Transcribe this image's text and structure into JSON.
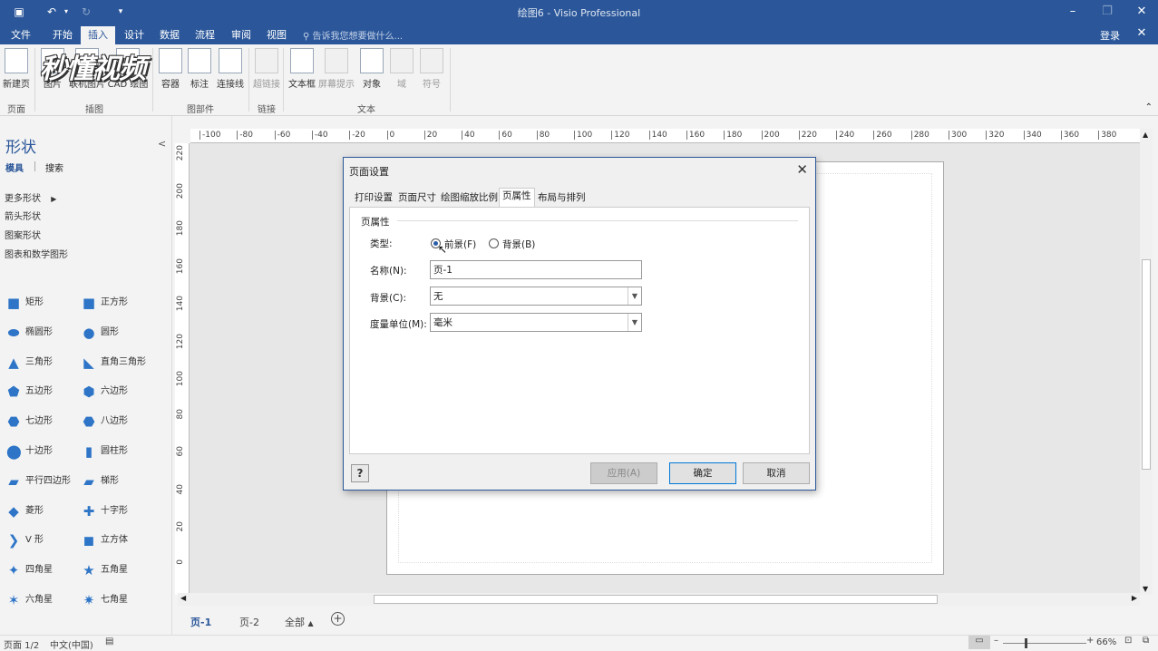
{
  "window": {
    "title": "绘图6 - Visio Professional"
  },
  "menu": {
    "items": [
      "文件",
      "开始",
      "插入",
      "设计",
      "数据",
      "流程",
      "审阅",
      "视图"
    ],
    "active": "插入",
    "tell_me": "告诉我您想要做什么...",
    "login": "登录"
  },
  "ribbon": {
    "buttons": [
      "新建页",
      "图片",
      "联机图片",
      "CAD 绘图",
      "容器",
      "标注",
      "连接线",
      "超链接",
      "屏幕提示",
      "文本框",
      "对象",
      "域",
      "符号"
    ],
    "groups": [
      "页面",
      "插图",
      "图部件",
      "链接",
      "文本"
    ]
  },
  "watermark": "秒懂视频",
  "sidebar": {
    "title": "形状",
    "tabs": [
      "模具",
      "搜索"
    ],
    "links": [
      "更多形状",
      "箭头形状",
      "图案形状",
      "图表和数学图形"
    ],
    "shapes": [
      [
        "矩形",
        "正方形"
      ],
      [
        "椭圆形",
        "圆形"
      ],
      [
        "三角形",
        "直角三角形"
      ],
      [
        "五边形",
        "六边形"
      ],
      [
        "七边形",
        "八边形"
      ],
      [
        "十边形",
        "圆柱形"
      ],
      [
        "平行四边形",
        "梯形"
      ],
      [
        "菱形",
        "十字形"
      ],
      [
        "V 形",
        "立方体"
      ],
      [
        "四角星",
        "五角星"
      ],
      [
        "六角星",
        "七角星"
      ]
    ]
  },
  "ruler": {
    "h": [
      "-100",
      "-80",
      "-60",
      "-40",
      "-20",
      "0",
      "20",
      "40",
      "60",
      "80",
      "100",
      "120",
      "140",
      "160",
      "180",
      "200",
      "220",
      "240",
      "260",
      "280",
      "300",
      "320",
      "340",
      "360",
      "380"
    ],
    "v": [
      "220",
      "200",
      "180",
      "160",
      "140",
      "120",
      "100",
      "80",
      "60",
      "40",
      "20",
      "0"
    ]
  },
  "page_tabs": {
    "tabs": [
      "页-1",
      "页-2",
      "全部"
    ],
    "active": "页-1"
  },
  "status": {
    "page": "页面 1/2",
    "lang": "中文(中国)",
    "zoom": "66%"
  },
  "dialog": {
    "title": "页面设置",
    "tabs": [
      "打印设置",
      "页面尺寸",
      "绘图缩放比例",
      "页属性",
      "布局与排列"
    ],
    "active_tab": "页属性",
    "section": "页属性",
    "type_label": "类型:",
    "type_options": [
      "前景(F)",
      "背景(B)"
    ],
    "type_selected": "前景(F)",
    "name_label": "名称(N):",
    "name_value": "页-1",
    "background_label": "背景(C):",
    "background_value": "无",
    "unit_label": "度量单位(M):",
    "unit_value": "毫米",
    "apply": "应用(A)",
    "ok": "确定",
    "cancel": "取消"
  }
}
